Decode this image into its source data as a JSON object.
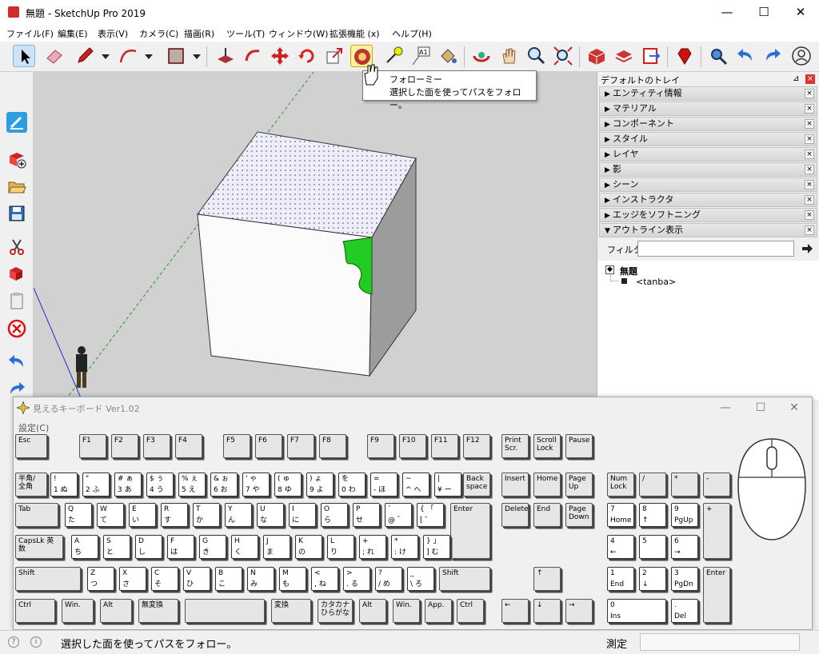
{
  "window": {
    "title": "無題 - SketchUp Pro 2019",
    "minimize": "—",
    "maximize": "☐",
    "close": "✕"
  },
  "menu": [
    "ファイル(F)",
    "編集(E)",
    "表示(V)",
    "カメラ(C)",
    "描画(R)",
    "ツール(T)",
    "ウィンドウ(W)",
    "拡張機能 (x)",
    "ヘルプ(H)"
  ],
  "toolbar": {
    "icons": [
      "select-icon",
      "eraser-icon",
      "pencil-icon",
      "arc-icon",
      "rectangle-icon",
      "push-pull-icon",
      "follow-me-icon",
      "move-icon",
      "rotate-icon",
      "scale-icon",
      "follow-me-icon",
      "tape-measure-icon",
      "text-icon",
      "paint-bucket-icon",
      "orbit-icon",
      "pan-icon",
      "zoom-icon",
      "zoom-extents-icon",
      "3d-warehouse-icon",
      "extension-warehouse-icon",
      "layout-icon",
      "ruby-icon",
      "previous-icon",
      "undo-icon",
      "redo-icon",
      "account-icon"
    ]
  },
  "tooltip": {
    "title": "フォローミー",
    "desc": "選択した面を使ってパスをフォロー。"
  },
  "tray": {
    "title": "デフォルトのトレイ",
    "sections": [
      "エンティティ情報",
      "マテリアル",
      "コンポーネント",
      "スタイル",
      "レイヤ",
      "影",
      "シーン",
      "インストラクタ",
      "エッジをソフトニング",
      "アウトライン表示"
    ],
    "filter_label": "フィルタ:",
    "filter_value": "",
    "outliner": {
      "root": "無題",
      "child": "<tanba>"
    }
  },
  "keyboard_window": {
    "title": "見えるキーボード Ver1.02",
    "menu": "設定(C)",
    "rows": [
      [
        {
          "c": "Esc"
        },
        {
          "c": "F1"
        },
        {
          "c": "F2"
        },
        {
          "c": "F3"
        },
        {
          "c": "F4"
        },
        {
          "c": "F5"
        },
        {
          "c": "F6"
        },
        {
          "c": "F7"
        },
        {
          "c": "F8"
        },
        {
          "c": "F9"
        },
        {
          "c": "F10"
        },
        {
          "c": "F11"
        },
        {
          "c": "F12"
        },
        {
          "c": "Print Scr."
        },
        {
          "c": "Scroll Lock"
        },
        {
          "c": "Pause"
        }
      ],
      [
        {
          "c": "半角/ 全角"
        },
        {
          "t": "!",
          "c": "1 ぬ"
        },
        {
          "t": "\"",
          "c": "2 ふ"
        },
        {
          "t": "# ぁ",
          "c": "3 あ"
        },
        {
          "t": "$ ぅ",
          "c": "4 う"
        },
        {
          "t": "% ぇ",
          "c": "5 え"
        },
        {
          "t": "& ぉ",
          "c": "6 お"
        },
        {
          "t": "' ゃ",
          "c": "7 や"
        },
        {
          "t": "( ゅ",
          "c": "8 ゆ"
        },
        {
          "t": ") ょ",
          "c": "9 よ"
        },
        {
          "t": "を",
          "c": "0 わ"
        },
        {
          "t": "=",
          "c": "- ほ"
        },
        {
          "t": "~",
          "c": "^ へ"
        },
        {
          "t": "|",
          "c": "¥ ー"
        },
        {
          "c": "Back space"
        },
        {
          "c": "Insert"
        },
        {
          "c": "Home"
        },
        {
          "c": "Page Up"
        },
        {
          "c": "Num Lock"
        },
        {
          "c": "/"
        },
        {
          "c": "*"
        },
        {
          "c": "-"
        }
      ],
      [
        {
          "c": "Tab"
        },
        {
          "t": "Q",
          "c": "た"
        },
        {
          "t": "W",
          "c": "て"
        },
        {
          "t": "E",
          "c": "い"
        },
        {
          "t": "R",
          "c": "す"
        },
        {
          "t": "T",
          "c": "か"
        },
        {
          "t": "Y",
          "c": "ん"
        },
        {
          "t": "U",
          "c": "な"
        },
        {
          "t": "I",
          "c": "に"
        },
        {
          "t": "O",
          "c": "ら"
        },
        {
          "t": "P",
          "c": "せ"
        },
        {
          "t": "`",
          "c": "@ ゛"
        },
        {
          "t": "{ 「",
          "c": "[ ゜"
        },
        {
          "c": "Enter"
        },
        {
          "c": "Delete"
        },
        {
          "c": "End"
        },
        {
          "c": "Page Down"
        },
        {
          "t": "7",
          "c": "Home"
        },
        {
          "t": "8",
          "c": "↑"
        },
        {
          "t": "9",
          "c": "PgUp"
        },
        {
          "c": "+"
        }
      ],
      [
        {
          "c": "CapsLk 英数"
        },
        {
          "t": "A",
          "c": "ち"
        },
        {
          "t": "S",
          "c": "と"
        },
        {
          "t": "D",
          "c": "し"
        },
        {
          "t": "F",
          "c": "は"
        },
        {
          "t": "G",
          "c": "き"
        },
        {
          "t": "H",
          "c": "く"
        },
        {
          "t": "J",
          "c": "ま"
        },
        {
          "t": "K",
          "c": "の"
        },
        {
          "t": "L",
          "c": "り"
        },
        {
          "t": "+",
          "c": "; れ"
        },
        {
          "t": "*",
          "c": ": け"
        },
        {
          "t": "} 」",
          "c": "] む"
        },
        {
          "t": "4",
          "c": "←"
        },
        {
          "t": "5",
          "c": ""
        },
        {
          "t": "6",
          "c": "→"
        }
      ],
      [
        {
          "c": "Shift"
        },
        {
          "t": "Z",
          "c": "つ"
        },
        {
          "t": "X",
          "c": "さ"
        },
        {
          "t": "C",
          "c": "そ"
        },
        {
          "t": "V",
          "c": "ひ"
        },
        {
          "t": "B",
          "c": "こ"
        },
        {
          "t": "N",
          "c": "み"
        },
        {
          "t": "M",
          "c": "も"
        },
        {
          "t": "<",
          "c": ", ね"
        },
        {
          "t": ">",
          "c": ". る"
        },
        {
          "t": "?",
          "c": "/ め"
        },
        {
          "t": "_",
          "c": "\\ ろ"
        },
        {
          "c": "Shift"
        },
        {
          "c": "↑"
        },
        {
          "t": "1",
          "c": "End"
        },
        {
          "t": "2",
          "c": "↓"
        },
        {
          "t": "3",
          "c": "PgDn"
        },
        {
          "c": "Enter"
        }
      ],
      [
        {
          "c": "Ctrl"
        },
        {
          "c": "Win."
        },
        {
          "c": "Alt"
        },
        {
          "c": "無変換"
        },
        {
          "c": ""
        },
        {
          "c": "変換"
        },
        {
          "c": "カタカナ ひらがな"
        },
        {
          "c": "Alt"
        },
        {
          "c": "Win."
        },
        {
          "c": "App."
        },
        {
          "c": "Ctrl"
        },
        {
          "c": "←"
        },
        {
          "c": "↓"
        },
        {
          "c": "→"
        },
        {
          "t": "0",
          "c": "Ins"
        },
        {
          "t": ".",
          "c": "Del"
        }
      ]
    ]
  },
  "status": {
    "text": "選択した面を使ってパスをフォロー。",
    "measure_label": "測定",
    "measure_value": ""
  }
}
